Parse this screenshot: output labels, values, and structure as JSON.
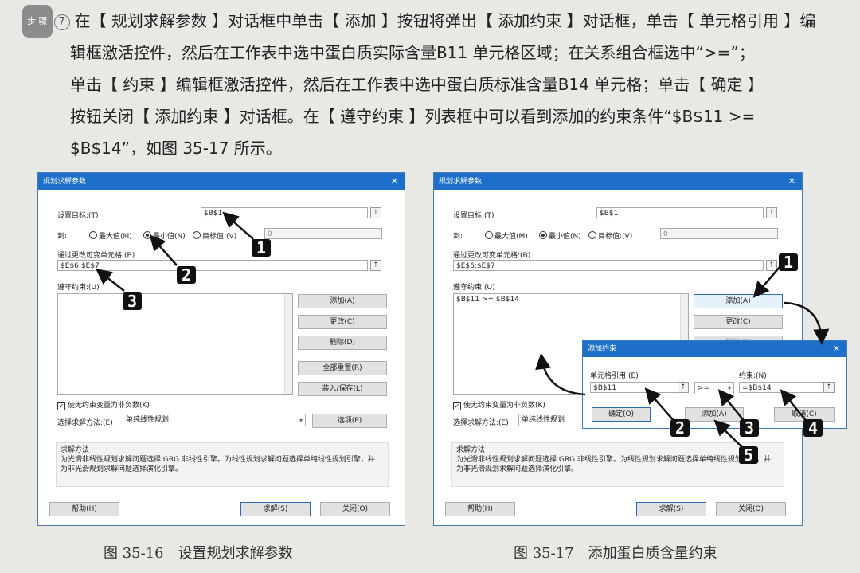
{
  "instruction": {
    "step_badge": "步 骤",
    "step_number": "7",
    "lines": [
      "在【 规划求解参数 】对话框中单击【 添加 】按钮将弹出【 添加约束 】对话框，单击【 单元格引用 】编",
      "辑框激活控件，然后在工作表中选中蛋白质实际含量B11 单元格区域；在关系组合框选中“>=”；",
      "单击【 约束 】编辑框激活控件，然后在工作表中选中蛋白质标准含量B14 单元格；单击【 确定 】",
      "按钮关闭【 添加约束 】对话框。在【 遵守约束 】列表框中可以看到添加的约束条件“$B$11 >=",
      "$B$14”，如图 35-17 所示。"
    ]
  },
  "figure1": {
    "title": "规划求解参数",
    "close": "✕",
    "set_objective_label": "设置目标:(T)",
    "set_objective_value": "$B$1",
    "to_label": "到:",
    "radio_max": "最大值(M)",
    "radio_min": "最小值(N)",
    "radio_target": "目标值:(V)",
    "target_value": "0",
    "changing_cells_label": "通过更改可变单元格:(B)",
    "changing_cells_value": "$E$6:$E$7",
    "constraints_label": "遵守约束:(U)",
    "btn_add": "添加(A)",
    "btn_change": "更改(C)",
    "btn_delete": "删除(D)",
    "btn_reset": "全部重置(R)",
    "btn_load": "装入/保存(L)",
    "nonneg_label": "使无约束变量为非负数(K)",
    "method_label": "选择求解方法:(E)",
    "method_value": "单纯线性规划",
    "btn_options": "选项(P)",
    "solve_method_title": "求解方法",
    "solve_method_desc1": "为光滑非线性规划求解问题选择 GRG 非线性引擎。为线性规划求解问题选择单纯线性规划引擎，并",
    "solve_method_desc2": "为非光滑规划求解问题选择演化引擎。",
    "btn_help": "帮助(H)",
    "btn_solve": "求解(S)",
    "btn_close": "关闭(O)",
    "badge1": "1",
    "badge2": "2",
    "badge3": "3",
    "caption": "图 35-16　设置规划求解参数"
  },
  "figure2": {
    "title": "规划求解参数",
    "close": "✕",
    "set_objective_label": "设置目标:(T)",
    "set_objective_value": "$B$1",
    "to_label": "到:",
    "radio_max": "最大值(M)",
    "radio_min": "最小值(N)",
    "radio_target": "目标值:(V)",
    "target_value": "0",
    "changing_cells_label": "通过更改可变单元格:(B)",
    "changing_cells_value": "$E$6:$E$7",
    "constraints_label": "遵守约束:(U)",
    "constraint_item": "$B$11 >= $B$14",
    "btn_add": "添加(A)",
    "btn_change": "更改(C)",
    "btn_delete_partial": "删除(D)",
    "nonneg_label": "使无约束变量为非负数(K)",
    "method_label": "选择求解方法:(E)",
    "method_value": "单纯线性规划",
    "solve_method_title": "求解方法",
    "solve_method_desc1": "为光滑非线性规划求解问题选择 GRG 非线性引擎。为线性规划求解问题选择单纯线性规划引擎，并",
    "solve_method_desc2": "为非光滑规划求解问题选择演化引擎。",
    "btn_help": "帮助(H)",
    "btn_solve": "求解(S)",
    "btn_close": "关闭(O)",
    "badge1": "1",
    "badge2": "2",
    "badge3": "3",
    "badge4": "4",
    "badge5": "5",
    "caption": "图 35-17　添加蛋白质含量约束",
    "add_dialog": {
      "title": "添加约束",
      "close": "✕",
      "cell_ref_label": "单元格引用:(E)",
      "cell_ref_value": "$B$11",
      "relation_value": ">=",
      "constraint_label": "约束:(N)",
      "constraint_value": "=$B$14",
      "btn_ok": "确定(O)",
      "btn_add": "添加(A)",
      "btn_cancel": "取消(C)"
    }
  }
}
